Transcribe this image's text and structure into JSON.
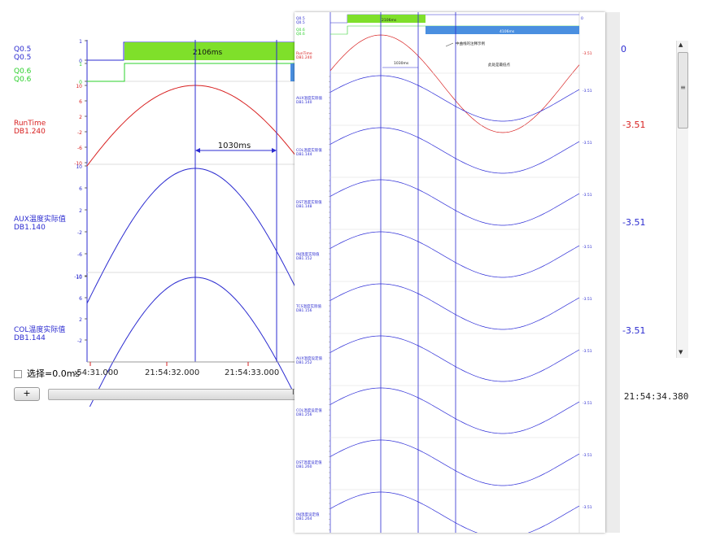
{
  "back_panel": {
    "signals": [
      {
        "name": "Q0.5",
        "address": "Q0.5",
        "color": "#2b2bd0"
      },
      {
        "name": "Q0.6",
        "address": "Q0.6",
        "color": "#2bd02b"
      },
      {
        "name": "RunTime",
        "address": "DB1.240",
        "color": "#d82020"
      },
      {
        "name": "AUX温度实际值",
        "address": "DB1.140",
        "color": "#2b2bd0"
      },
      {
        "name": "COL温度实际值",
        "address": "DB1.144",
        "color": "#2b2bd0"
      }
    ],
    "digital_ticks": [
      "1",
      "0",
      "1",
      "0"
    ],
    "runtime_ticks": [
      "10",
      "6",
      "2",
      "-2",
      "-6",
      "-10"
    ],
    "aux_ticks": [
      "10",
      "6",
      "2",
      "-2",
      "-6",
      "-10"
    ],
    "col_ticks": [
      "10",
      "6",
      "2",
      "-2"
    ],
    "pulse_label": "2106ms",
    "interval_label": "1030ms",
    "right_values": [
      "-3.51",
      "-3.51",
      "-3.51"
    ],
    "right_digital_value": "0",
    "select_label": "选择=0.0ms",
    "time_axis": [
      ":54:31.000",
      "21:54:32.000",
      "21:54:33.000"
    ],
    "end_time": "21 21:54:34.380",
    "add_button_label": "+",
    "hscroll_grip": "III",
    "vscroll_grip": "≡",
    "colors": {
      "blue": "#2b2bd0",
      "green": "#7fe02a",
      "red": "#d82020",
      "bar_blue": "#4a8fe0"
    }
  },
  "front_panel": {
    "top_signals": [
      "Q0.5",
      "Q0.5",
      "Q0.6",
      "Q0.6"
    ],
    "pulse_label": "2106ms",
    "bar_label": "4106ms",
    "runtime_label": "RunTime",
    "runtime_address": "DB1.240",
    "annotation_1": "中曲线的注释示例",
    "annotation_2": "此处是最低点",
    "interval_label": "1030ms",
    "channels": [
      {
        "name": "AUX温度实际值",
        "address": "DB1.140"
      },
      {
        "name": "COL温度实际值",
        "address": "DB1.144"
      },
      {
        "name": "DST温度实际值",
        "address": "DB1.148"
      },
      {
        "name": "INJ温度实际值",
        "address": "DB1.152"
      },
      {
        "name": "TCS温度实际值",
        "address": "DB1.156"
      },
      {
        "name": "AUX温度设定值",
        "address": "DB1.252"
      },
      {
        "name": "COL温度设定值",
        "address": "DB1.256"
      },
      {
        "name": "DST温度设定值",
        "address": "DB1.260"
      },
      {
        "name": "INJ温度设定值",
        "address": "DB1.264"
      }
    ],
    "right_value": "-3.51",
    "right_digital_value": "0"
  }
}
